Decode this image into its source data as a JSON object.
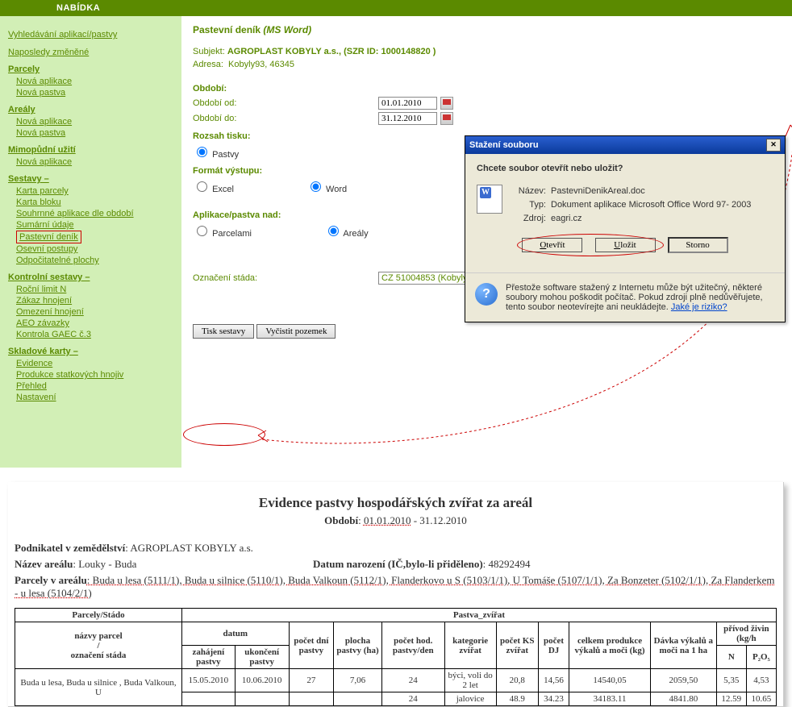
{
  "topbar": "NABÍDKA",
  "sidebar": {
    "search": "Vyhledávání aplikací/pastvy",
    "recent": "Naposledy změněné",
    "parcely": {
      "hdr": "Parcely",
      "new_app": "Nová aplikace",
      "new_past": "Nová pastva"
    },
    "arealy": {
      "hdr": "Areály",
      "new_app": "Nová aplikace",
      "new_past": "Nová pastva"
    },
    "mimop": {
      "hdr": "Mimopůdní užití",
      "new_app": "Nová aplikace"
    },
    "sestavy": {
      "hdr": "Sestavy –",
      "items": [
        "Karta parcely",
        "Karta bloku",
        "Souhrnné aplikace dle období",
        "Sumární údaje",
        "Pastevní deník",
        "Osevní postupy",
        "Odpočitatelné plochy"
      ]
    },
    "kontrol": {
      "hdr": "Kontrolní sestavy –",
      "items": [
        "Roční limit N",
        "Zákaz hnojení",
        "Omezení hnojení",
        "AEO závazky",
        "Kontrola GAEC č.3"
      ]
    },
    "sklad": {
      "hdr": "Skladové karty –",
      "items": [
        "Evidence",
        "Produkce statkových hnojiv",
        "Přehled",
        "Nastavení"
      ]
    }
  },
  "content": {
    "title": "Pastevní deník",
    "title_note": "(MS Word)",
    "subj_lbl": "Subjekt:",
    "subj": "AGROPLAST KOBYLY a.s., (SZR ID: 1000148820 )",
    "adr_lbl": "Adresa:",
    "adr": "Kobyly93, 46345",
    "period": "Období:",
    "from_lbl": "Období od:",
    "from": "01.01.2010",
    "to_lbl": "Období do:",
    "to": "31.12.2010",
    "rozsah": "Rozsah tisku:",
    "r_past": "Pastvy",
    "format": "Formát výstupu:",
    "f_excel": "Excel",
    "f_word": "Word",
    "apl": "Aplikace/pastva nad:",
    "a_parc": "Parcelami",
    "a_areal": "Areály",
    "stado_lbl": "Označení stáda:",
    "stado": "CZ 51004853 (Kobyly, 93)",
    "tisk": "Tisk sestavy",
    "vycist": "Vyčistit pozemek"
  },
  "dialog": {
    "title": "Stažení souboru",
    "q": "Chcete soubor otevřít nebo uložit?",
    "name_k": "Název:",
    "name_v": "PastevniDenikAreal.doc",
    "typ_k": "Typ:",
    "typ_v": "Dokument aplikace Microsoft Office Word 97- 2003",
    "zdr_k": "Zdroj:",
    "zdr_v": "eagri.cz",
    "open": "Otevřít",
    "save": "Uložit",
    "cancel": "Storno",
    "warn": "Přestože software stažený z Internetu může být užitečný, některé soubory mohou poškodit počítač. Pokud zdroji plně nedůvěřujete, tento soubor neotevírejte ani neukládejte. ",
    "risk": "Jaké je riziko?"
  },
  "doc": {
    "h": "Evidence pastvy hospodářských zvířat za areál",
    "per_lbl": "Období",
    "per1": "01.01.2010",
    "per2": " - 31.12.2010",
    "p1": "Podnikatel v zemědělství",
    "p1v": ": AGROPLAST KOBYLY a.s.",
    "p2": "Název areálu",
    "p2v": ": Louky - Buda",
    "p2b": "Datum narození (IČ,bylo-li přiděleno)",
    "p2bv": ": 48292494",
    "p3": "Parcely v areálu",
    "p3v": ": Buda u lesa (5111/1), Buda u silnice (5110/1), Buda Valkoun (5112/1), Flanderkovo u S (5103/1/1), U Tomáše (5107/1/1), Za Bonzeter (5102/1/1), Za Flanderkem - u lesa (5104/2/1)",
    "th": {
      "ps": "Parcely/Stádo",
      "nez": "názvy parcel",
      "slash": "/",
      "oz": "označení stáda",
      "datum": "datum",
      "zah": "zahájení pastvy",
      "uk": "ukončení pastvy",
      "dni": "počet dní pastvy",
      "plo": "plocha pastvy (ha)",
      "hod": "počet hod. pastvy/den",
      "kat": "kategorie zvířat",
      "ks": "počet KS zvířat",
      "dj": "počet DJ",
      "pz": "Pastva_zvířat",
      "celk": "celkem produkce výkalů a moči (kg)",
      "dav": "Dávka výkalů a moči na 1 ha",
      "prz": "přívod živin (kg/h",
      "n": "N",
      "p": "P₂O₅"
    },
    "rows": [
      {
        "a": "",
        "b": "15.05.2010",
        "c": "10.06.2010",
        "d": "27",
        "e": "7,06",
        "f": "24",
        "g": "býci, voli do 2 let",
        "h": "20,8",
        "i": "14,56",
        "j": "14540,05",
        "k": "2059,50",
        "l": "5,35",
        "m": "4,53"
      },
      {
        "a": "Buda u lesa, Buda u silnice , Buda Valkoun, U",
        "b": "",
        "c": "",
        "d": "",
        "e": "",
        "f": "24",
        "g": "jalovice",
        "h": "48.9",
        "i": "34.23",
        "j": "34183.11",
        "k": "4841.80",
        "l": "12.59",
        "m": "10.65"
      }
    ]
  }
}
